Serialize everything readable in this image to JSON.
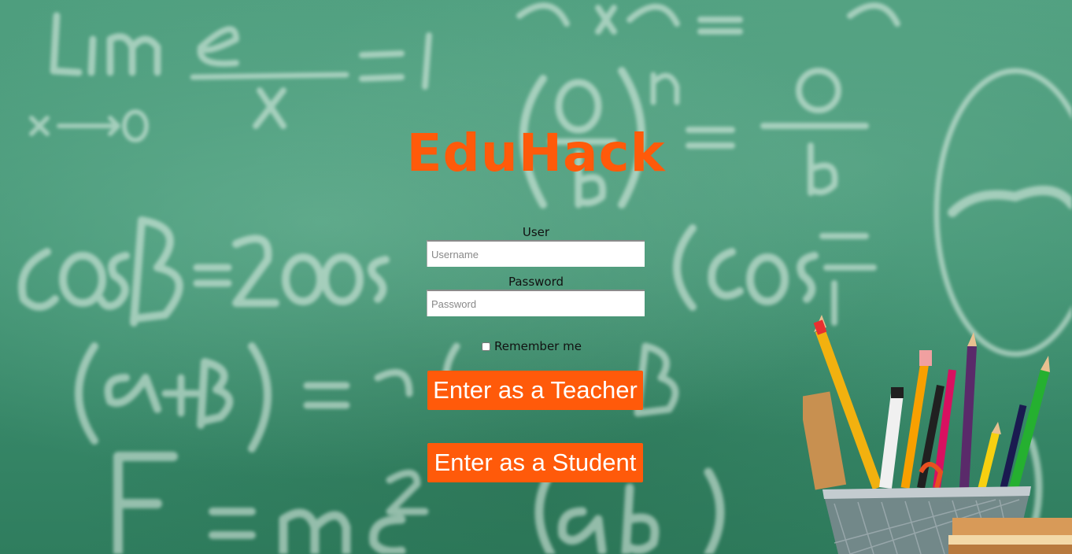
{
  "brand": {
    "title": "EduHack"
  },
  "login": {
    "user_label": "User",
    "username_placeholder": "Username",
    "password_label": "Password",
    "password_placeholder": "Password",
    "remember_label": "Remember me",
    "teacher_button": "Enter as a Teacher",
    "student_button": "Enter as a Student"
  },
  "colors": {
    "accent": "#ff5a0a",
    "board": "#3f9272"
  }
}
